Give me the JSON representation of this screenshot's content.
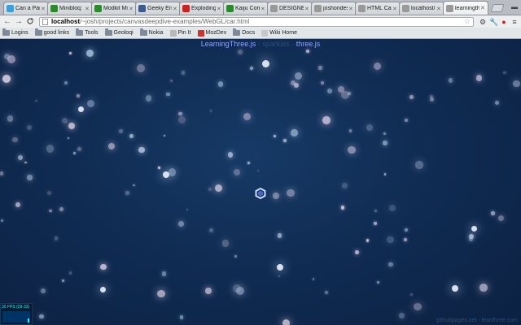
{
  "tabs": [
    {
      "label": "Can a Parki",
      "color": "#3aa0d8"
    },
    {
      "label": "Minibloq: gi",
      "color": "#2c8a2c"
    },
    {
      "label": "Modkit Micr",
      "color": "#2c8a2c"
    },
    {
      "label": "Geeky End",
      "color": "#3c5a8c"
    },
    {
      "label": "Exploding",
      "color": "#cc2222"
    },
    {
      "label": "Kaiju Comb",
      "color": "#2c8a2c"
    },
    {
      "label": "DESIGNER",
      "color": "#999999"
    },
    {
      "label": "joshondes",
      "color": "#999999"
    },
    {
      "label": "HTML Canv",
      "color": "#999999"
    },
    {
      "label": "localhost/",
      "color": "#999999"
    },
    {
      "label": "learningthr",
      "color": "#999999",
      "active": true
    }
  ],
  "toolbar": {
    "back": "←",
    "forward": "→",
    "reload": "C",
    "url_host": "localhost",
    "url_path": "/~josh/projects/canvasdeepdive-examples/WebGL/car.html"
  },
  "bookmarks": [
    {
      "label": "Logins",
      "type": "folder"
    },
    {
      "label": "good links",
      "type": "folder"
    },
    {
      "label": "Tools",
      "type": "folder"
    },
    {
      "label": "Geoloqi",
      "type": "folder"
    },
    {
      "label": "Nokia",
      "type": "folder"
    },
    {
      "label": "Pin It",
      "type": "page",
      "color": "#b8b8b8"
    },
    {
      "label": "MozDev",
      "type": "page",
      "color": "#cc3333"
    },
    {
      "label": "Docs",
      "type": "folder"
    },
    {
      "label": "Wiki Home",
      "type": "page",
      "color": "#c8c8c8"
    }
  ],
  "content": {
    "credit_link1": "LearningThree.js",
    "credit_mid": " - sparkles - ",
    "credit_link2": "three.js",
    "fps": "30 FPS (29-33)",
    "credit_bottom": "githubpages.net - leanthree.com"
  }
}
